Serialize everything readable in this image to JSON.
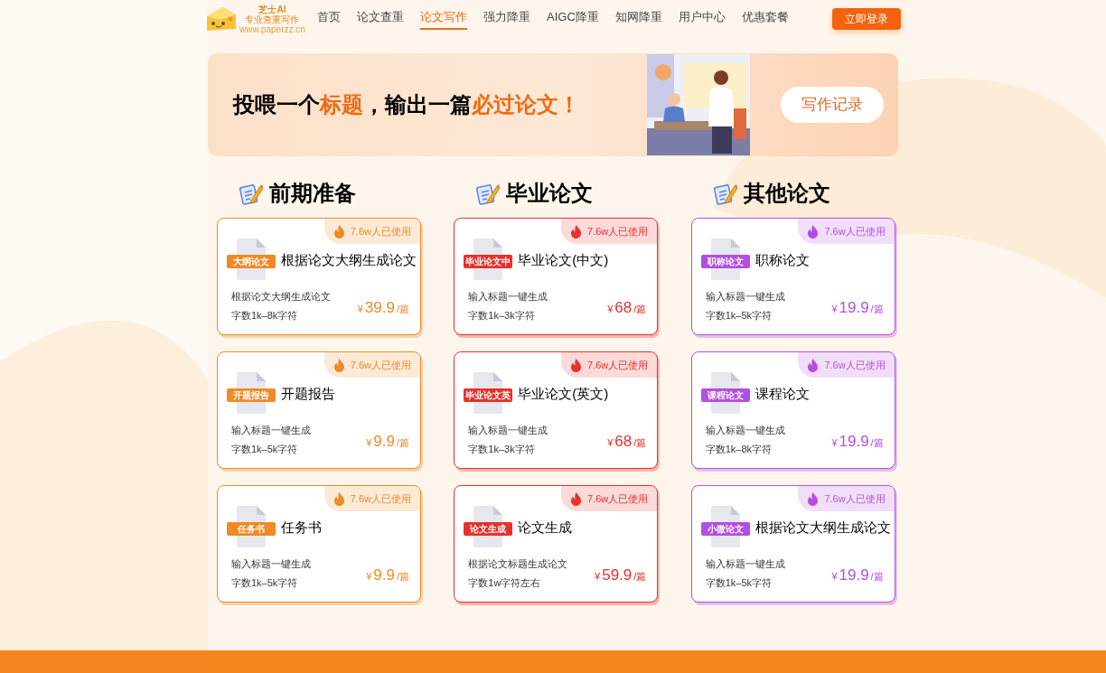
{
  "logo": {
    "name": "芝士AI",
    "slogan": "专业查重写作",
    "url": "www.paperzz.cn"
  },
  "nav": [
    {
      "label": "首页",
      "selected": false
    },
    {
      "label": "论文查重",
      "selected": false
    },
    {
      "label": "论文写作",
      "selected": true
    },
    {
      "label": "强力降重",
      "selected": false
    },
    {
      "label": "AIGC降重",
      "selected": false
    },
    {
      "label": "知网降重",
      "selected": false
    },
    {
      "label": "用户中心",
      "selected": false
    },
    {
      "label": "优惠套餐",
      "selected": false
    }
  ],
  "login_button": "立即登录",
  "banner": {
    "headline": [
      {
        "text": "投喂一个",
        "highlight": false
      },
      {
        "text": "标题",
        "highlight": true
      },
      {
        "text": "，输出一篇",
        "highlight": false
      },
      {
        "text": "必过论文！",
        "highlight": true
      }
    ],
    "button": "写作记录"
  },
  "columns": [
    {
      "title": "前期准备",
      "color": "#f08a24",
      "cards": [
        {
          "tag": "大纲论文",
          "title": "根据论文大纲生成论文",
          "desc": "根据论文大纲生成论文",
          "length": "字数1k–8k字符",
          "currency": "¥",
          "price": "39.9",
          "unit": "/篇",
          "usage": "7.6w人已使用"
        },
        {
          "tag": "开题报告",
          "title": "开题报告",
          "desc": "输入标题一键生成",
          "length": "字数1k–5k字符",
          "currency": "¥",
          "price": "9.9",
          "unit": "/篇",
          "usage": "7.6w人已使用"
        },
        {
          "tag": "任务书",
          "title": "任务书",
          "desc": "输入标题一键生成",
          "length": "字数1k–5k字符",
          "currency": "¥",
          "price": "9.9",
          "unit": "/篇",
          "usage": "7.6w人已使用"
        }
      ]
    },
    {
      "title": "毕业论文",
      "color": "#e8302c",
      "cards": [
        {
          "tag": "毕业论文中",
          "title": "毕业论文(中文)",
          "desc": "输入标题一键生成",
          "length": "字数1k–3k字符",
          "currency": "¥",
          "price": "68",
          "unit": "/篇",
          "usage": "7.6w人已使用"
        },
        {
          "tag": "毕业论文英",
          "title": "毕业论文(英文)",
          "desc": "输入标题一键生成",
          "length": "字数1k–3k字符",
          "currency": "¥",
          "price": "68",
          "unit": "/篇",
          "usage": "7.6w人已使用"
        },
        {
          "tag": "论文生成",
          "title": "论文生成",
          "desc": "根据论文标题生成论文",
          "length": "字数1w字符左右",
          "currency": "¥",
          "price": "59.9",
          "unit": "/篇",
          "usage": "7.6w人已使用"
        }
      ]
    },
    {
      "title": "其他论文",
      "color": "#b34fe0",
      "cards": [
        {
          "tag": "职称论文",
          "title": "职称论文",
          "desc": "输入标题一键生成",
          "length": "字数1k–5k字符",
          "currency": "¥",
          "price": "19.9",
          "unit": "/篇",
          "usage": "7.6w人已使用"
        },
        {
          "tag": "课程论文",
          "title": "课程论文",
          "desc": "输入标题一键生成",
          "length": "字数1k–8k字符",
          "currency": "¥",
          "price": "19.9",
          "unit": "/篇",
          "usage": "7.6w人已使用"
        },
        {
          "tag": "小微论文",
          "title": "根据论文大纲生成论文",
          "desc": "输入标题一键生成",
          "length": "字数1k–5k字符",
          "currency": "¥",
          "price": "19.9",
          "unit": "/篇",
          "usage": "7.6w人已使用"
        }
      ]
    }
  ]
}
